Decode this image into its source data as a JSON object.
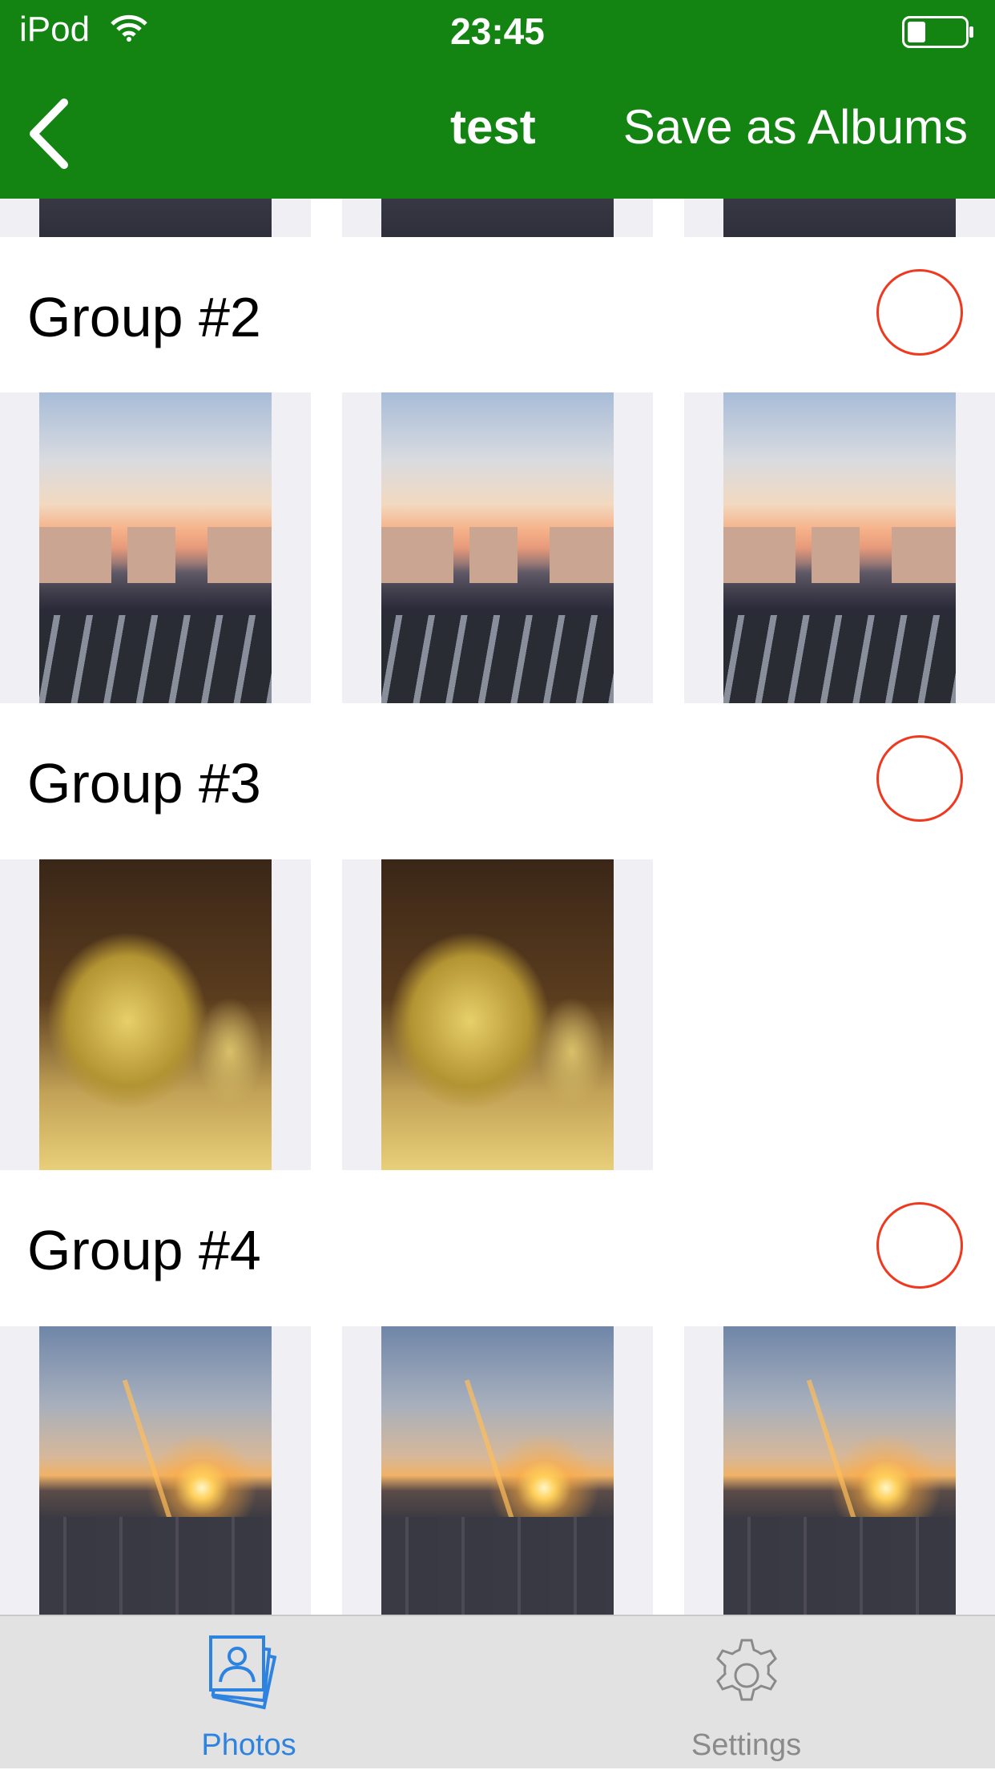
{
  "status_bar": {
    "carrier": "iPod",
    "time": "23:45"
  },
  "nav": {
    "title": "test",
    "save_label": "Save as Albums"
  },
  "groups": [
    {
      "title": "Group #2"
    },
    {
      "title": "Group #3"
    },
    {
      "title": "Group #4"
    }
  ],
  "tabs": [
    {
      "label": "Photos",
      "icon": "photos-icon",
      "selected": true
    },
    {
      "label": "Settings",
      "icon": "gear-icon",
      "selected": false
    }
  ],
  "colors": {
    "nav_background": "#138412",
    "select_circle": "#f0381e",
    "tab_active": "#2f83e0",
    "tab_inactive": "#8a8a8a"
  }
}
